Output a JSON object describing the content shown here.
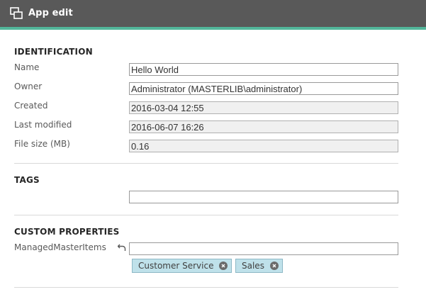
{
  "window": {
    "title": "App edit",
    "icon": "app-edit-icon"
  },
  "identification": {
    "heading": "IDENTIFICATION",
    "fields": [
      {
        "label": "Name",
        "value": "Hello World",
        "editable": true
      },
      {
        "label": "Owner",
        "value": "Administrator (MASTERLIB\\administrator)",
        "editable": true
      },
      {
        "label": "Created",
        "value": "2016-03-04 12:55",
        "editable": false
      },
      {
        "label": "Last modified",
        "value": "2016-06-07 16:26",
        "editable": false
      },
      {
        "label": "File size (MB)",
        "value": "0.16",
        "editable": false
      }
    ]
  },
  "tags": {
    "heading": "TAGS",
    "value": ""
  },
  "custom_properties": {
    "heading": "CUSTOM PROPERTIES",
    "items": [
      {
        "label": "ManagedMasterItems",
        "value": "",
        "revert_icon": "undo-icon",
        "chips": [
          "Customer Service",
          "Sales"
        ]
      }
    ]
  },
  "colors": {
    "titlebar": "#595959",
    "accent": "#52b69a",
    "chip_bg": "#bfe1ea"
  }
}
